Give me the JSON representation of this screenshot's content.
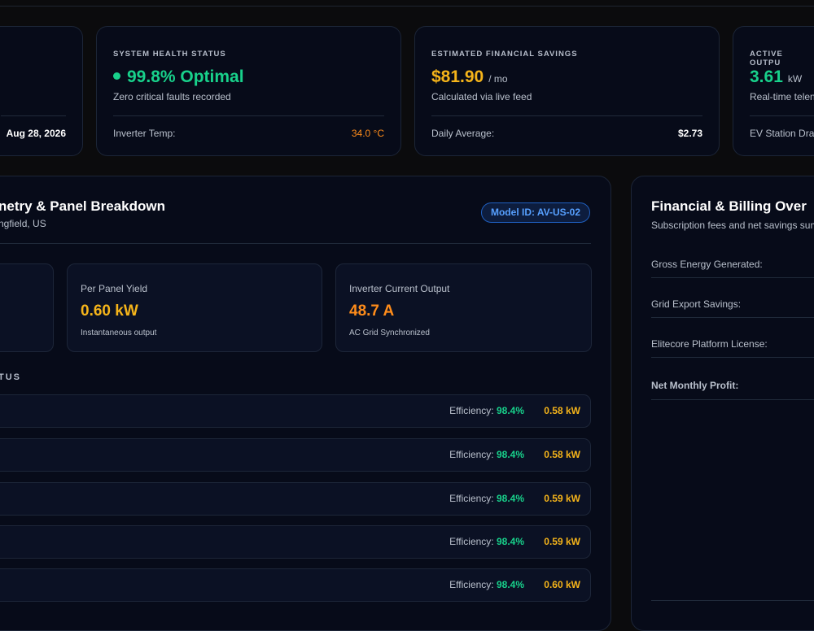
{
  "kpi_partial": {
    "date": "Aug 28, 2026"
  },
  "kpi_health": {
    "label": "SYSTEM HEALTH STATUS",
    "value": "99.8% Optimal",
    "sub": "Zero critical faults recorded",
    "foot_label": "Inverter Temp:",
    "foot_value": "34.0 °C"
  },
  "kpi_savings": {
    "label": "ESTIMATED FINANCIAL SAVINGS",
    "value": "$81.90",
    "unit": "/ mo",
    "sub": "Calculated via live feed",
    "foot_label": "Daily Average:",
    "foot_value": "$2.73"
  },
  "kpi_output": {
    "label": "ACTIVE OUTPU",
    "value": "3.61",
    "unit": "kW",
    "sub": "Real-time telen",
    "foot_label": "EV Station Dra"
  },
  "telemetry": {
    "title": "netry & Panel Breakdown",
    "location": "ngfield, US",
    "badge": "Model ID: AV-US-02",
    "metrics": [
      {
        "label": "Per Panel Yield",
        "value": "0.60 kW",
        "sub": "Instantaneous output"
      },
      {
        "label": "Inverter Current Output",
        "value": "48.7 A",
        "sub": "AC Grid Synchronized"
      }
    ],
    "status_heading": "TUS",
    "efficiency_label": "Efficiency:",
    "panels": [
      {
        "efficiency": "98.4%",
        "output": "0.58 kW"
      },
      {
        "efficiency": "98.4%",
        "output": "0.58 kW"
      },
      {
        "efficiency": "98.4%",
        "output": "0.59 kW"
      },
      {
        "efficiency": "98.4%",
        "output": "0.59 kW"
      },
      {
        "efficiency": "98.4%",
        "output": "0.60 kW"
      }
    ]
  },
  "financial": {
    "title": "Financial & Billing Over",
    "subtitle": "Subscription fees and net savings sum",
    "rows": [
      "Gross Energy Generated:",
      "Grid Export Savings:",
      "Elitecore Platform License:",
      "Net Monthly Profit:"
    ]
  },
  "colors": {
    "background": "#0b0b0d",
    "card": "#070b19",
    "green": "#18d18b",
    "gold": "#f5b41a",
    "orange": "#ff8c1a",
    "badge_blue": "#57a0ff"
  }
}
